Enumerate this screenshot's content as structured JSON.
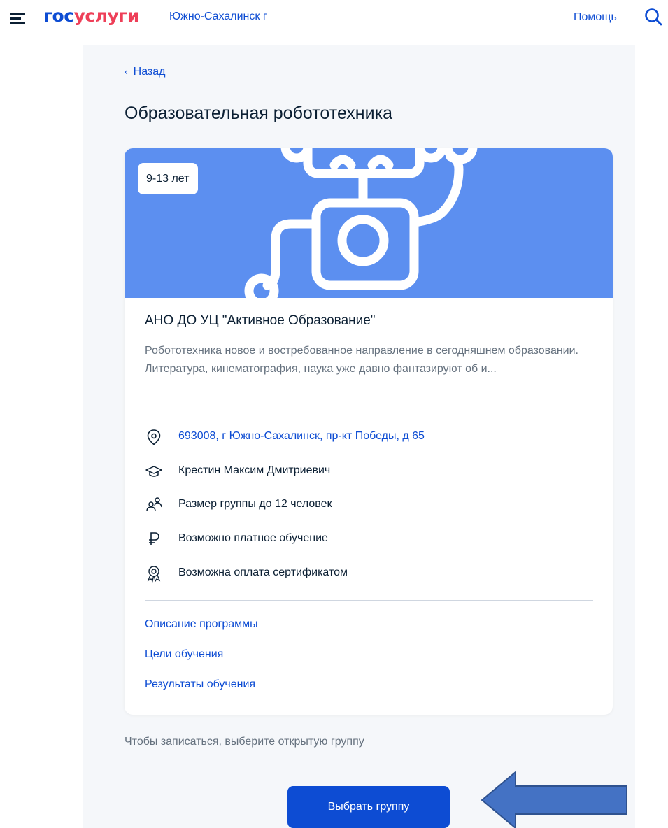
{
  "header": {
    "logo_part1": "гос",
    "logo_part2": "услуги",
    "location": "Южно-Сахалинск г",
    "help": "Помощь",
    "icons": [
      "menu-icon",
      "search-icon"
    ]
  },
  "nav": {
    "back_label": "Назад"
  },
  "page": {
    "title": "Образовательная робототехника"
  },
  "card": {
    "age_badge": "9-13 лет",
    "org_name": "АНО ДО УЦ \"Активное Образование\"",
    "description": "Робототехника новое и востребованное направление в сегодняшнем образовании. Литература, кинематография, наука уже давно фантазируют об и...",
    "details": [
      {
        "icon": "location-pin-icon",
        "text": "693008, г Южно-Сахалинск, пр-кт Победы, д 65"
      },
      {
        "icon": "graduation-cap-icon",
        "text": "Крестин Максим Дмитриевич"
      },
      {
        "icon": "people-icon",
        "text": "Размер группы до 12 человек"
      },
      {
        "icon": "ruble-icon",
        "text": "Возможно платное обучение"
      },
      {
        "icon": "certificate-icon",
        "text": "Возможна оплата сертификатом"
      }
    ],
    "links": [
      "Описание программы",
      "Цели обучения",
      "Результаты обучения"
    ]
  },
  "footer": {
    "hint": "Чтобы записаться, выберите открытую группу",
    "button_label": "Выбрать группу"
  },
  "colors": {
    "brand_blue": "#0d4cd3",
    "brand_red": "#ee3f58",
    "banner_blue": "#5c8ff0",
    "arrow_blue": "#4472c4",
    "page_bg": "#f5f7fa"
  }
}
